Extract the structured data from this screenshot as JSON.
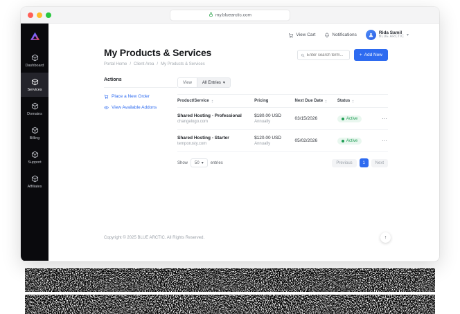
{
  "browser": {
    "url": "my.bluearctic.com"
  },
  "sidebar": {
    "items": [
      {
        "label": "Dashboard"
      },
      {
        "label": "Services"
      },
      {
        "label": "Domains"
      },
      {
        "label": "Billing"
      },
      {
        "label": "Support"
      },
      {
        "label": "Affiliates"
      }
    ]
  },
  "header": {
    "view_cart": "View Cart",
    "notifications": "Notifications",
    "user_name": "Rida Samil",
    "user_org": "BLUE ARCTIC"
  },
  "page": {
    "title": "My Products & Services",
    "breadcrumb": [
      "Portal Home",
      "Client Area",
      "My Products & Services"
    ],
    "breadcrumb_sep": "/",
    "search_placeholder": "Enter search term...",
    "add_new_label": "Add New"
  },
  "actions": {
    "title": "Actions",
    "links": [
      {
        "label": "Place a New Order"
      },
      {
        "label": "View Available Addons"
      }
    ]
  },
  "table": {
    "view_label": "View",
    "filter_value": "All Entries",
    "columns": [
      "Product/Service",
      "Pricing",
      "Next Due Date",
      "Status"
    ],
    "rows": [
      {
        "product": "Shared Hosting - Professional",
        "domain": "changelogo.com",
        "price": "$180.00 USD",
        "cycle": "Annually",
        "due": "03/15/2026",
        "status": "Active"
      },
      {
        "product": "Shared Hosting - Starter",
        "domain": "temporusty.com",
        "price": "$120.00 USD",
        "cycle": "Annually",
        "due": "05/02/2026",
        "status": "Active"
      }
    ],
    "show_label": "Show",
    "show_value": "50",
    "entries_label": "entries",
    "pagination": {
      "previous": "Previous",
      "page": "1",
      "next": "Next"
    }
  },
  "footer": {
    "copyright": "Copyright © 2025 BLUE ARCTIC. All Rights Reserved."
  },
  "icons": {
    "plus": "+",
    "chevron": "▾",
    "dots": "⋯",
    "arrow_up": "↑"
  },
  "colors": {
    "accent": "#2e6bf0",
    "status_green": "#1f9e54",
    "sidebar_bg": "#0a0a0d"
  }
}
